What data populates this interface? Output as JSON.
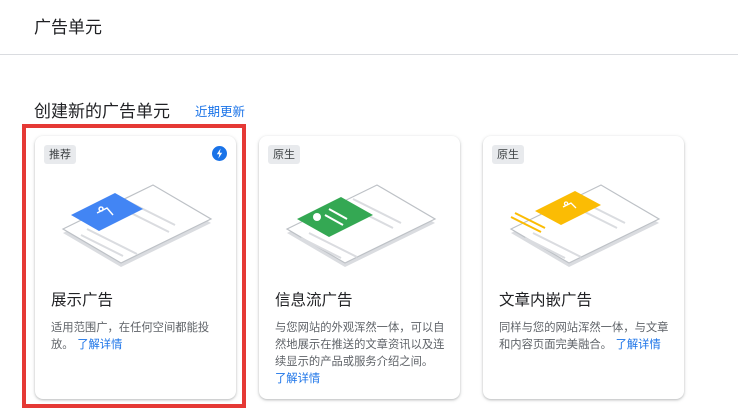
{
  "header": {
    "title": "广告单元"
  },
  "section": {
    "title": "创建新的广告单元",
    "link": "近期更新"
  },
  "cards": [
    {
      "badge": "推荐",
      "title": "展示广告",
      "desc": "适用范围广，在任何空间都能投放。",
      "link": "了解详情",
      "accent": "#4285f4"
    },
    {
      "badge": "原生",
      "title": "信息流广告",
      "desc": "与您网站的外观浑然一体，可以自然地展示在推送的文章资讯以及连续显示的产品或服务介绍之间。",
      "link": "了解详情",
      "accent": "#34a853"
    },
    {
      "badge": "原生",
      "title": "文章内嵌广告",
      "desc": "同样与您的网站浑然一体，与文章和内容页面完美融合。",
      "link": "了解详情",
      "accent": "#fbbc04"
    }
  ],
  "icons": {
    "recommended": "bolt-icon"
  },
  "colors": {
    "link": "#1a73e8",
    "highlight": "#e53935"
  }
}
